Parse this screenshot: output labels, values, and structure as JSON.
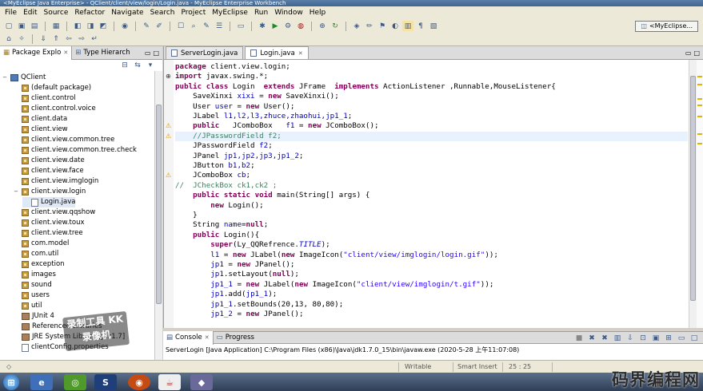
{
  "window": {
    "title": "<MyEclipse Java Enterprise> - QClient/client/view/login/Login.java - MyEclipse Enterprise Workbench"
  },
  "menu": [
    "File",
    "Edit",
    "Source",
    "Refactor",
    "Navigate",
    "Search",
    "Project",
    "MyEclipse",
    "Run",
    "Window",
    "Help"
  ],
  "perspective": {
    "label": "<MyEclipse..."
  },
  "left_panel": {
    "tabs": [
      "Package Explo",
      "Type Hierarch"
    ],
    "tree": [
      {
        "label": "QClient",
        "type": "project",
        "expand": "−"
      },
      {
        "label": "(default package)",
        "type": "package"
      },
      {
        "label": "client.control",
        "type": "package"
      },
      {
        "label": "client.control.voice",
        "type": "package"
      },
      {
        "label": "client.data",
        "type": "package"
      },
      {
        "label": "client.view",
        "type": "package"
      },
      {
        "label": "client.view.common.tree",
        "type": "package"
      },
      {
        "label": "client.view.common.tree.check",
        "type": "package"
      },
      {
        "label": "client.view.date",
        "type": "package"
      },
      {
        "label": "client.view.face",
        "type": "package"
      },
      {
        "label": "client.view.imglogin",
        "type": "package"
      },
      {
        "label": "client.view.login",
        "type": "package",
        "expand": "−"
      },
      {
        "label": "Login.java",
        "type": "java",
        "selected": true
      },
      {
        "label": "client.view.qqshow",
        "type": "package"
      },
      {
        "label": "client.view.toux",
        "type": "package"
      },
      {
        "label": "client.view.tree",
        "type": "package"
      },
      {
        "label": "com.model",
        "type": "package"
      },
      {
        "label": "com.util",
        "type": "package"
      },
      {
        "label": "exception",
        "type": "package"
      },
      {
        "label": "images",
        "type": "package"
      },
      {
        "label": "sound",
        "type": "package"
      },
      {
        "label": "users",
        "type": "package"
      },
      {
        "label": "util",
        "type": "package"
      },
      {
        "label": "JUnit 4",
        "type": "jar"
      },
      {
        "label": "Referenced Libraries",
        "type": "jar"
      },
      {
        "label": "JRE System Library [jdk1.7]",
        "type": "jar"
      },
      {
        "label": "clientConfig.properties",
        "type": "file"
      }
    ]
  },
  "editor": {
    "tabs": [
      "ServerLogin.java",
      "Login.java"
    ],
    "active_tab": 1,
    "lines": [
      [
        [
          "kw",
          "package "
        ],
        [
          "",
          "client.view.login;"
        ]
      ],
      [
        [
          "kw",
          "import "
        ],
        [
          "",
          "javax.swing.*;"
        ]
      ],
      [
        [
          "kw",
          "public class "
        ],
        [
          "",
          "Login  "
        ],
        [
          "kw",
          "extends "
        ],
        [
          "",
          "JFrame  "
        ],
        [
          "kw",
          "implements "
        ],
        [
          "",
          "ActionListener ,Runnable,MouseListener{"
        ]
      ],
      [
        [
          "",
          "    SaveXinxi "
        ],
        [
          "fd",
          "xixi"
        ],
        [
          "",
          " = "
        ],
        [
          "kw",
          "new "
        ],
        [
          "",
          "SaveXinxi();"
        ]
      ],
      [
        [
          "",
          "    User "
        ],
        [
          "fd",
          "user"
        ],
        [
          "",
          " = "
        ],
        [
          "kw",
          "new "
        ],
        [
          "",
          "User();"
        ]
      ],
      [
        [
          "",
          "    JLabel "
        ],
        [
          "fd",
          "l1,l2,l3,zhuce,zhaohui,jp1_1"
        ],
        [
          "",
          ";"
        ]
      ],
      [
        [
          "kw",
          "    public "
        ],
        [
          "",
          "  JComboBox   "
        ],
        [
          "fd",
          "f1"
        ],
        [
          "",
          " = "
        ],
        [
          "kw",
          "new "
        ],
        [
          "",
          "JComboBox();"
        ]
      ],
      [
        [
          "cm",
          "    //JPasswordField f2;"
        ]
      ],
      [
        [
          "",
          "    JPasswordField "
        ],
        [
          "fd",
          "f2"
        ],
        [
          "",
          ";"
        ]
      ],
      [
        [
          "",
          "    JPanel "
        ],
        [
          "fd",
          "jp1,jp2,jp3,jp1_2"
        ],
        [
          "",
          ";"
        ]
      ],
      [
        [
          "",
          "    JButton "
        ],
        [
          "fd",
          "b1,b2"
        ],
        [
          "",
          ";"
        ]
      ],
      [
        [
          "",
          "    JComboBox "
        ],
        [
          "fd",
          "cb"
        ],
        [
          "",
          ";"
        ]
      ],
      [
        [
          "cm",
          "//  JCheckBox ck1,ck2 ;"
        ]
      ],
      [
        [
          "kw",
          "    public static void "
        ],
        [
          "",
          "main(String[] args) {"
        ]
      ],
      [
        [
          "",
          "        "
        ],
        [
          "kw",
          "new "
        ],
        [
          "",
          "Login();"
        ]
      ],
      [
        [
          "",
          "    }"
        ]
      ],
      [
        [
          "",
          "    String "
        ],
        [
          "fd",
          "name"
        ],
        [
          "",
          "="
        ],
        [
          "kw",
          "null"
        ],
        [
          "",
          ";"
        ]
      ],
      [
        [
          "kw",
          "    public "
        ],
        [
          "",
          "Login(){"
        ]
      ],
      [
        [
          "",
          "        "
        ],
        [
          "kw",
          "super"
        ],
        [
          "",
          "(Ly_QQRefrence."
        ],
        [
          "it",
          "TITLE"
        ],
        [
          "",
          ");"
        ]
      ],
      [
        [
          "",
          "        "
        ],
        [
          "fd",
          "l1"
        ],
        [
          "",
          " = "
        ],
        [
          "kw",
          "new "
        ],
        [
          "",
          "JLabel("
        ],
        [
          "kw",
          "new "
        ],
        [
          "",
          "ImageIcon("
        ],
        [
          "st",
          "\"client/view/imglogin/login.gif\""
        ],
        [
          "",
          "));"
        ]
      ],
      [
        [
          "",
          "        "
        ],
        [
          "fd",
          "jp1"
        ],
        [
          "",
          " = "
        ],
        [
          "kw",
          "new "
        ],
        [
          "",
          "JPanel();"
        ]
      ],
      [
        [
          "",
          "        "
        ],
        [
          "fd",
          "jp1"
        ],
        [
          "",
          ".setLayout("
        ],
        [
          "kw",
          "null"
        ],
        [
          "",
          ");"
        ]
      ],
      [
        [
          "",
          "        "
        ],
        [
          "fd",
          "jp1_1"
        ],
        [
          "",
          " = "
        ],
        [
          "kw",
          "new "
        ],
        [
          "",
          "JLabel("
        ],
        [
          "kw",
          "new "
        ],
        [
          "",
          "ImageIcon("
        ],
        [
          "st",
          "\"client/view/imglogin/t.gif\""
        ],
        [
          "",
          "));"
        ]
      ],
      [
        [
          "",
          "        "
        ],
        [
          "fd",
          "jp1"
        ],
        [
          "",
          ".add("
        ],
        [
          "fd",
          "jp1_1"
        ],
        [
          "",
          ");"
        ]
      ],
      [
        [
          "",
          "        "
        ],
        [
          "fd",
          "jp1_1"
        ],
        [
          "",
          ".setBounds(20,13, 80,80);"
        ]
      ],
      [
        [
          "",
          "        "
        ],
        [
          "fd",
          "jp1_2"
        ],
        [
          "",
          " = "
        ],
        [
          "kw",
          "new "
        ],
        [
          "",
          "JPanel();"
        ]
      ]
    ]
  },
  "console": {
    "tabs": [
      "Console",
      "Progress"
    ],
    "text": "ServerLogin [Java Application] C:\\Program Files (x86)\\Java\\jdk1.7.0_15\\bin\\javaw.exe (2020-5-28 上午11:07:08)"
  },
  "status": {
    "writable": "Writable",
    "insert": "Smart Insert",
    "position": "25 : 25"
  },
  "watermarks": {
    "left": "录制工具 KK录像机",
    "bottom_right": "码界编程网"
  }
}
